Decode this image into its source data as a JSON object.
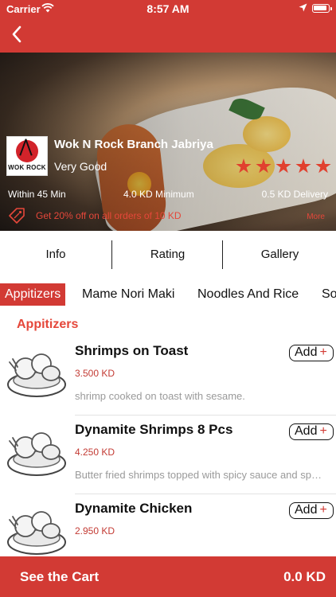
{
  "status_bar": {
    "carrier": "Carrier",
    "time": "8:57 AM"
  },
  "colors": {
    "brand_red": "#d23a34",
    "accent_red": "#e5473a",
    "muted_text": "#9a9a9a"
  },
  "restaurant": {
    "name": "Wok N Rock Branch Jabriya",
    "logo_text": "WOK ROCK",
    "quality": "Very Good",
    "rating_stars": 5,
    "delivery_time": "Within 45 Min",
    "minimum": "4.0 KD Minimum",
    "delivery_fee": "0.5 KD Delivery",
    "offer": "Get 20% off on all orders of 10 KD",
    "more_label": "More"
  },
  "tabs": [
    "Info",
    "Rating",
    "Gallery"
  ],
  "categories": [
    "Appitizers",
    "Mame Nori Maki",
    "Noodles And Rice",
    "Soups"
  ],
  "section": {
    "title": "Appitizers"
  },
  "items": [
    {
      "title": "Shrimps on Toast",
      "price": "3.500 KD",
      "description": "shrimp cooked on toast with sesame.",
      "add_label": "Add",
      "add_symbol": "+"
    },
    {
      "title": "Dynamite Shrimps 8 Pcs",
      "price": "4.250 KD",
      "description": "Butter fried shrimps topped with spicy sauce and spring onion",
      "add_label": "Add",
      "add_symbol": "+"
    },
    {
      "title": "Dynamite Chicken",
      "price": "2.950 KD",
      "description": "",
      "add_label": "Add",
      "add_symbol": "+"
    }
  ],
  "cart": {
    "label": "See the Cart",
    "total": "0.0 KD"
  },
  "icons": [
    "wifi-icon",
    "location-arrow-icon",
    "battery-icon",
    "back-chevron-icon",
    "star-icon",
    "offer-tag-icon",
    "food-plate-icon"
  ]
}
